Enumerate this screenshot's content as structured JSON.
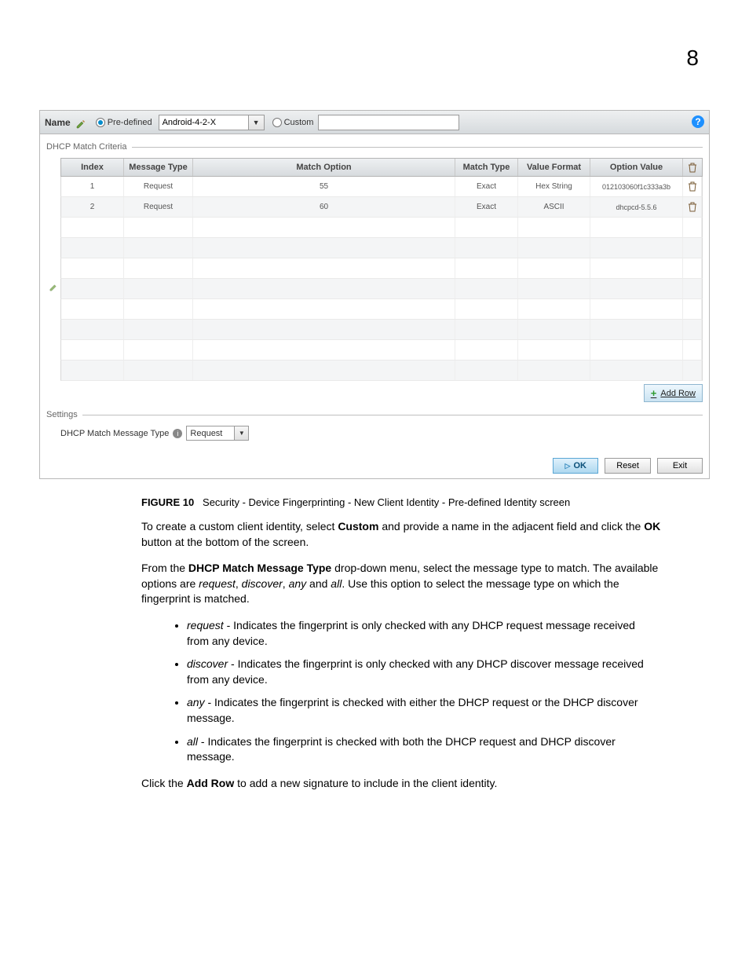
{
  "page": {
    "number": "8"
  },
  "header": {
    "nameLabel": "Name",
    "predefinedLabel": "Pre-defined",
    "customLabel": "Custom",
    "selectedName": "Android-4-2-X"
  },
  "fieldset1": {
    "legend": "DHCP Match Criteria"
  },
  "table": {
    "headers": {
      "index": "Index",
      "messageType": "Message Type",
      "matchOption": "Match Option",
      "matchType": "Match Type",
      "valueFormat": "Value Format",
      "optionValue": "Option Value"
    },
    "rows": [
      {
        "index": "1",
        "messageType": "Request",
        "matchOption": "55",
        "matchType": "Exact",
        "valueFormat": "Hex String",
        "optionValue": "012103060f1c333a3b"
      },
      {
        "index": "2",
        "messageType": "Request",
        "matchOption": "60",
        "matchType": "Exact",
        "valueFormat": "ASCII",
        "optionValue": "dhcpcd-5.5.6"
      },
      {
        "index": "",
        "messageType": "",
        "matchOption": "",
        "matchType": "",
        "valueFormat": "",
        "optionValue": ""
      },
      {
        "index": "",
        "messageType": "",
        "matchOption": "",
        "matchType": "",
        "valueFormat": "",
        "optionValue": ""
      },
      {
        "index": "",
        "messageType": "",
        "matchOption": "",
        "matchType": "",
        "valueFormat": "",
        "optionValue": ""
      },
      {
        "index": "",
        "messageType": "",
        "matchOption": "",
        "matchType": "",
        "valueFormat": "",
        "optionValue": ""
      },
      {
        "index": "",
        "messageType": "",
        "matchOption": "",
        "matchType": "",
        "valueFormat": "",
        "optionValue": ""
      },
      {
        "index": "",
        "messageType": "",
        "matchOption": "",
        "matchType": "",
        "valueFormat": "",
        "optionValue": ""
      },
      {
        "index": "",
        "messageType": "",
        "matchOption": "",
        "matchType": "",
        "valueFormat": "",
        "optionValue": ""
      },
      {
        "index": "",
        "messageType": "",
        "matchOption": "",
        "matchType": "",
        "valueFormat": "",
        "optionValue": ""
      }
    ],
    "addRowLabel": "Add Row"
  },
  "fieldset2": {
    "legend": "Settings"
  },
  "settings": {
    "label": "DHCP Match Message Type",
    "value": "Request"
  },
  "buttons": {
    "ok": "OK",
    "reset": "Reset",
    "exit": "Exit"
  },
  "figure": {
    "label": "FIGURE 10",
    "caption": "Security - Device Fingerprinting - New Client Identity - Pre-defined Identity screen"
  },
  "para1_a": "To create a custom client identity, select ",
  "para1_b": "Custom",
  "para1_c": " and provide a name in the adjacent field and click the ",
  "para1_d": "OK",
  "para1_e": " button at the bottom of the screen.",
  "para2_a": "From the ",
  "para2_b": "DHCP Match Message Type",
  "para2_c": " drop-down menu, select the message type to match. The available options are ",
  "para2_d": "request",
  "para2_e": ", ",
  "para2_f": "discover",
  "para2_g": ", ",
  "para2_h": "any",
  "para2_i": " and ",
  "para2_j": "all",
  "para2_k": ". Use this option to select the message type on which the fingerprint is matched.",
  "bullets": [
    {
      "term": "request",
      "text": " - Indicates the fingerprint is only checked with any DHCP request message received from any device."
    },
    {
      "term": "discover",
      "text": " - Indicates the fingerprint is only checked with any DHCP discover message received from any device."
    },
    {
      "term": "any",
      "text": " - Indicates the fingerprint is checked with either the DHCP request or the DHCP discover message."
    },
    {
      "term": "all",
      "text": " - Indicates the fingerprint is checked with both the DHCP request and DHCP discover message."
    }
  ],
  "para3_a": "Click the ",
  "para3_b": "Add Row",
  "para3_c": " to add a new signature to include in the client identity."
}
